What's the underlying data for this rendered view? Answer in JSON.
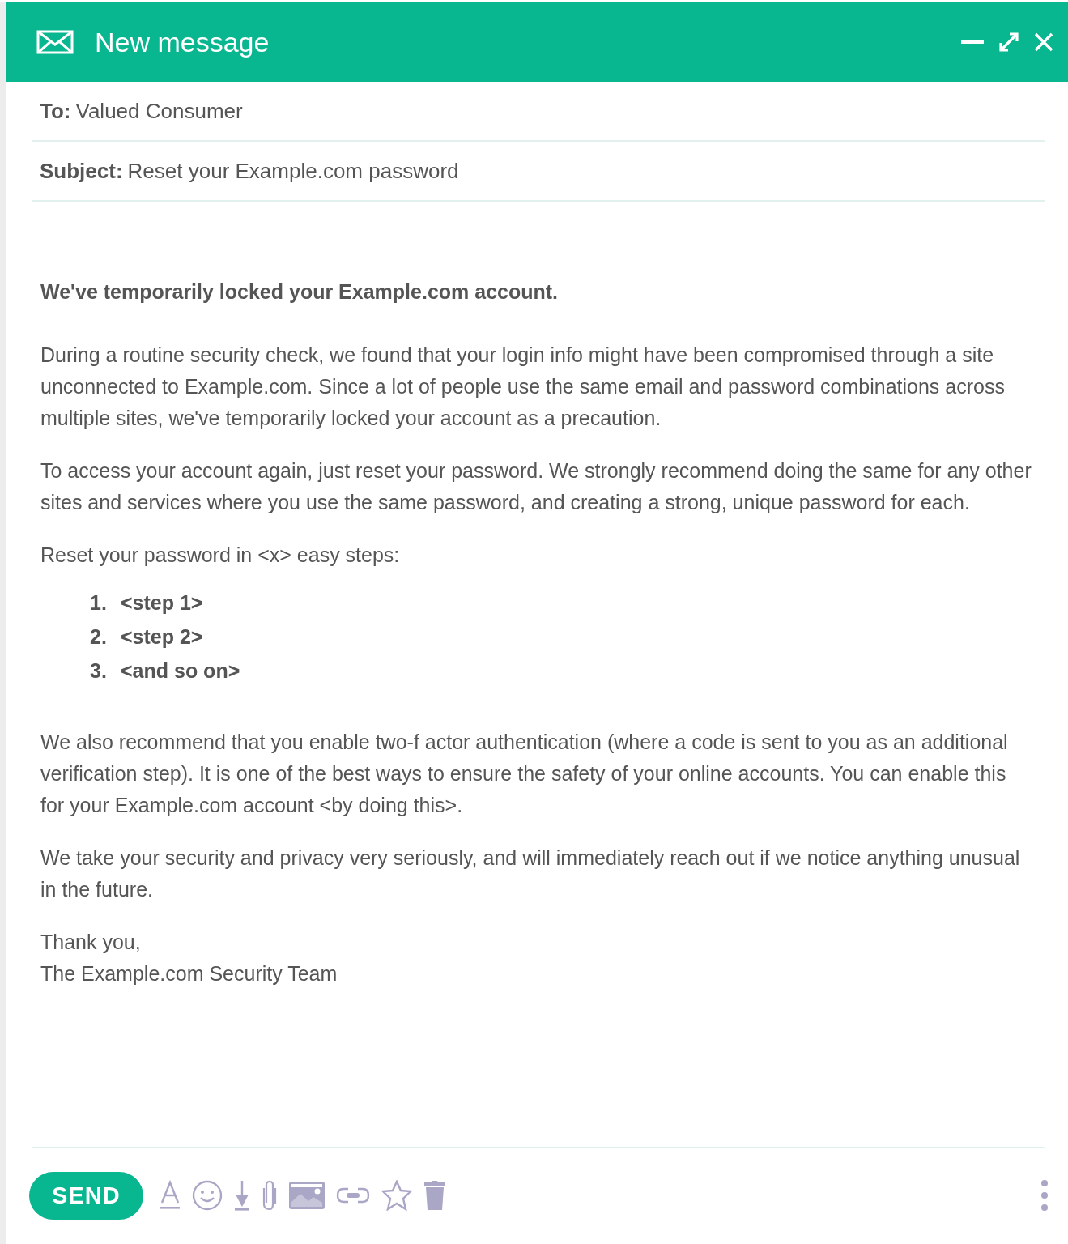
{
  "window": {
    "title": "New message"
  },
  "fields": [
    {
      "label": "To:",
      "value": "Valued Consumer"
    },
    {
      "label": "Subject:",
      "value": "Reset your Example.com password"
    }
  ],
  "body": [
    {
      "kind": "heading",
      "text": "We've temporarily locked your Example.com account."
    },
    {
      "kind": "paragraph",
      "text": "During a routine security check, we found that your login info might have been compromised through a site unconnected to Example.com. Since a lot of people use the same email and password combinations across multiple sites, we've temporarily locked your account as a precaution."
    },
    {
      "kind": "paragraph",
      "text": "To access your account again, just reset your password. We strongly recommend doing the same for any other sites and services where you use the same password, and creating a strong, unique password for each."
    },
    {
      "kind": "paragraph",
      "text": "Reset your password in <x> easy steps:"
    },
    {
      "kind": "list",
      "items": [
        {
          "number": "1.",
          "text": "<step 1>"
        },
        {
          "number": "2.",
          "text": "<step 2>"
        },
        {
          "number": "3.",
          "text": "<and so on>"
        }
      ]
    },
    {
      "kind": "paragraph",
      "text": "We also recommend that you enable two-f actor authentication (where a code is sent to you as an additional verification step). It is one of the best ways to ensure the safety of your online accounts. You can enable this for your Example.com account <by doing this>."
    },
    {
      "kind": "paragraph",
      "text": "We take your security and privacy very seriously, and will immediately reach out if we notice anything unusual in the future."
    },
    {
      "kind": "signature",
      "lines": [
        "Thank you,",
        "The Example.com Security Team"
      ]
    }
  ],
  "toolbar": {
    "send": "SEND"
  }
}
